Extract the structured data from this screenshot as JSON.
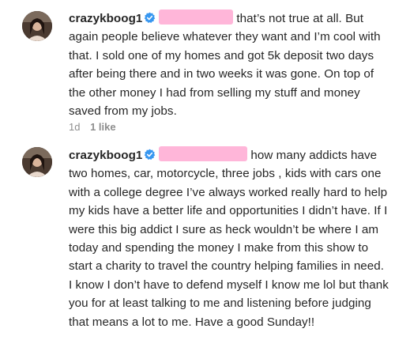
{
  "comments": [
    {
      "username": "crazykboog1",
      "text": "that’s not true at all. But again people believe whatever they want and I’m cool with that. I sold one of my homes and got 5k deposit two days after being there and in two weeks it was gone. On top of the other money I had from selling my stuff and money saved from my jobs.",
      "time": "1d",
      "likes": "1 like"
    },
    {
      "username": "crazykboog1",
      "text": "how many addicts have two homes, car, motorcycle, three jobs , kids with cars one with a college degree I’ve always worked really hard to help my kids have a better life and opportunities I didn’t have. If I were this big addict I sure as heck wouldn’t be where I am today and spending the money I make from this show to start a charity to travel the country helping families in need. I know I don’t have to defend myself I know me lol but thank you for at least talking to me and listening before judging that means a lot to me. Have a good Sunday!!"
    }
  ],
  "icons": {
    "verified": "verified-badge-icon",
    "avatar": "profile-avatar"
  },
  "colors": {
    "verified": "#3897f0",
    "redaction": "#ffb6d9",
    "meta": "#8e8e8e"
  }
}
